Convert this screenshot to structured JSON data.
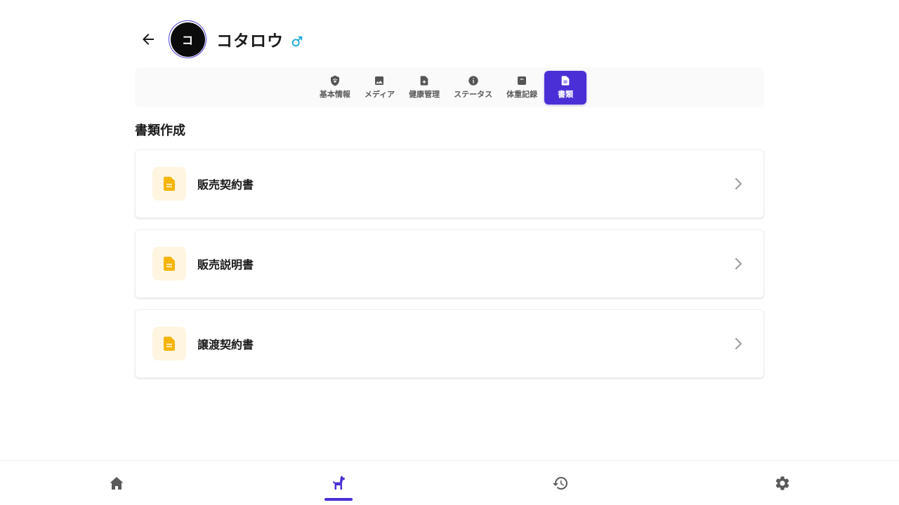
{
  "header": {
    "pet_name": "コタロウ",
    "avatar_initial": "コ",
    "sex_symbol": "male-symbol-icon"
  },
  "tabs": [
    {
      "label": "基本情報",
      "icon": "shield-paw-icon",
      "active": false
    },
    {
      "label": "メディア",
      "icon": "image-icon",
      "active": false
    },
    {
      "label": "健康管理",
      "icon": "medical-file-icon",
      "active": false
    },
    {
      "label": "ステータス",
      "icon": "info-icon",
      "active": false
    },
    {
      "label": "体重記録",
      "icon": "weight-icon",
      "active": false
    },
    {
      "label": "書類",
      "icon": "document-icon",
      "active": true
    }
  ],
  "section": {
    "title": "書類作成"
  },
  "documents": [
    {
      "label": "販売契約書",
      "icon": "document-icon"
    },
    {
      "label": "販売説明書",
      "icon": "document-icon"
    },
    {
      "label": "譲渡契約書",
      "icon": "document-icon"
    }
  ],
  "bottom_nav": [
    {
      "icon": "home-icon",
      "active": false
    },
    {
      "icon": "dog-icon",
      "active": true
    },
    {
      "icon": "history-icon",
      "active": false
    },
    {
      "icon": "gear-icon",
      "active": false
    }
  ],
  "colors": {
    "accent": "#4b2fd6",
    "doc_icon": "#f5b400",
    "doc_icon_bg": "#fff5e0",
    "sex_icon": "#1aa6d6"
  }
}
